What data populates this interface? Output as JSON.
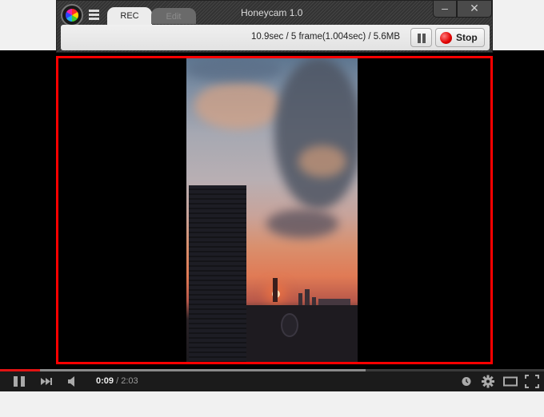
{
  "honeycam": {
    "title": "Honeycam 1.0",
    "tabs": [
      {
        "label": "REC",
        "active": true
      },
      {
        "label": "Edit",
        "active": false
      }
    ],
    "status": "10.9sec / 5 frame(1.004sec) / 5.6MB",
    "pause_icon": "pause-icon",
    "stop_label": "Stop",
    "stop_icon": "record-dot-icon",
    "minimize_glyph": "–",
    "close_glyph": "✕"
  },
  "recording_region": {
    "outline_color": "#ff0000"
  },
  "player": {
    "current_time": "0:09",
    "separator": " / ",
    "duration": "2:03",
    "played_fraction": 0.073,
    "buffered_fraction": 0.672,
    "accent_color": "#e21313",
    "controls": [
      "pause",
      "next",
      "volume",
      "watch-later",
      "settings",
      "theater",
      "fullscreen"
    ]
  }
}
